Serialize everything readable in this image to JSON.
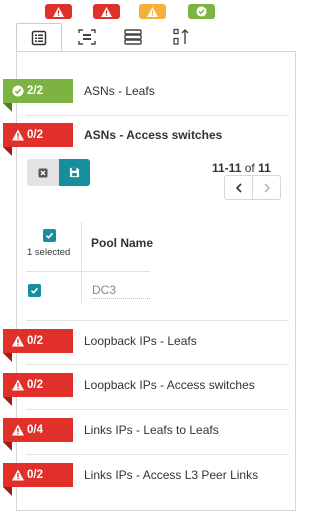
{
  "status_badges": [
    {
      "state": "error",
      "icon": "warning-icon",
      "color": "#e1302a"
    },
    {
      "state": "error",
      "icon": "warning-icon",
      "color": "#e1302a"
    },
    {
      "state": "warning",
      "icon": "warning-icon",
      "color": "#f4b13a"
    },
    {
      "state": "ok",
      "icon": "check-circle-icon",
      "color": "#7cb342"
    }
  ],
  "tabs": [
    {
      "icon": "list-icon",
      "active": true
    },
    {
      "icon": "scan-icon",
      "active": false
    },
    {
      "icon": "server-stack-icon",
      "active": false
    },
    {
      "icon": "sort-icon",
      "active": false
    }
  ],
  "sections": [
    {
      "badge": "2/2",
      "status": "ok",
      "label": "ASNs - Leafs"
    },
    {
      "badge": "0/2",
      "status": "error",
      "label": "ASNs - Access switches"
    },
    {
      "badge": "0/2",
      "status": "error",
      "label": "Loopback IPs - Leafs"
    },
    {
      "badge": "0/2",
      "status": "error",
      "label": "Loopback IPs - Access switches"
    },
    {
      "badge": "0/4",
      "status": "error",
      "label": "Links IPs - Leafs to Leafs"
    },
    {
      "badge": "0/2",
      "status": "error",
      "label": "Links IPs - Access L3 Peer Links"
    }
  ],
  "pagination": {
    "range": "11-11",
    "of_label": "of",
    "total": "11"
  },
  "table": {
    "selected_count": "1 selected",
    "column_header": "Pool Name",
    "rows": [
      {
        "checked": true,
        "pool_name": "DC3"
      }
    ]
  },
  "colors": {
    "accent": "#168e9e",
    "error": "#e1302a",
    "ok": "#7cb342",
    "warning": "#f4b13a"
  }
}
